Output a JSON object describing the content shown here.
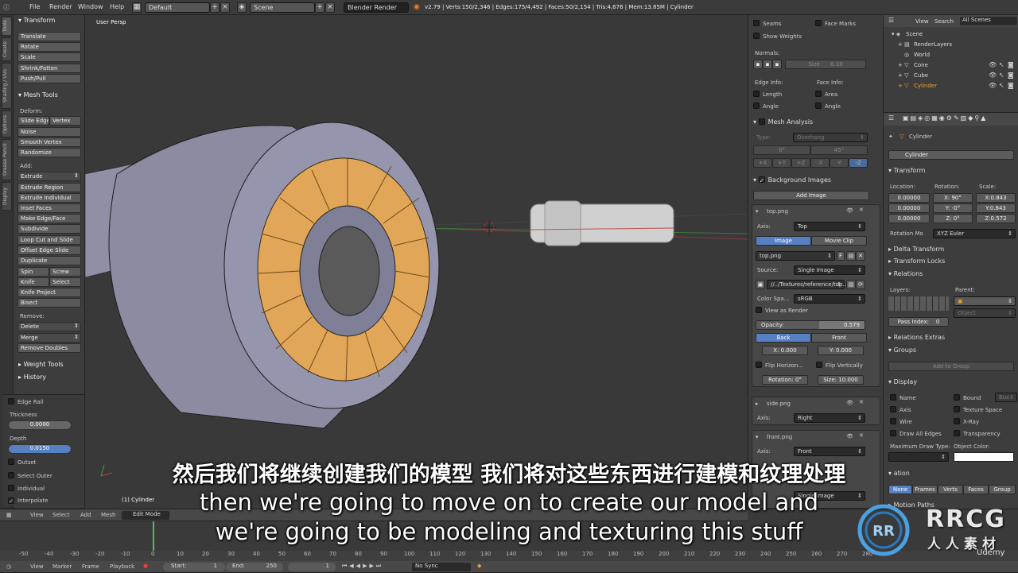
{
  "topbar": {
    "menus": [
      "File",
      "Render",
      "Window",
      "Help"
    ],
    "layout": "Default",
    "scene": "Scene",
    "engine": "Blender Render",
    "stats": "v2.79 | Verts:150/2,346 | Edges:175/4,492 | Faces:50/2,154 | Tris:4,676 | Mem:13.85M | Cylinder"
  },
  "toolshelf": {
    "tabs": [
      "Tools",
      "Create",
      "Shading / UVs",
      "Options",
      "Grease Pencil",
      "Display"
    ],
    "transform_title": "Transform",
    "transform_buttons": [
      "Translate",
      "Rotate",
      "Scale",
      "Shrink/Fatten",
      "Push/Pull"
    ],
    "mesh_tools_title": "Mesh Tools",
    "deform_label": "Deform:",
    "slide_edge": "Slide Edge",
    "vertex": "Vertex",
    "noise": "Noise",
    "smooth_vertex": "Smooth Vertex",
    "randomize": "Randomize",
    "add_label": "Add:",
    "extrude": "Extrude",
    "add_buttons": [
      "Extrude Region",
      "Extrude Individual",
      "Inset Faces",
      "Make Edge/Face",
      "Subdivide",
      "Loop Cut and Slide",
      "Offset Edge Slide",
      "Duplicate"
    ],
    "spin": "Spin",
    "screw": "Screw",
    "knife": "Knife",
    "select": "Select",
    "knife_project": "Knife Project",
    "bisect": "Bisect",
    "remove_label": "Remove:",
    "delete": "Delete",
    "merge": "Merge",
    "remove_doubles": "Remove Doubles",
    "weight_tools": "Weight Tools",
    "history": "History",
    "op_edge_rail": "Edge Rail",
    "op_thickness_label": "Thickness",
    "op_thickness": "0.0000",
    "op_depth_label": "Depth",
    "op_depth": "0.0150",
    "op_outset": "Outset",
    "op_select_outer": "Select Outer",
    "op_individual": "Individual",
    "op_interpolate": "Interpolate"
  },
  "viewport": {
    "title": "User Persp",
    "object_label": "(1) Cylinder"
  },
  "nprop": {
    "seams": "Seams",
    "face_marks": "Face Marks",
    "show_weights": "Show Weights",
    "normals": "Normals:",
    "size_label": "Size",
    "size_value": "0.10",
    "edge_info": "Edge Info:",
    "face_info": "Face Info:",
    "length": "Length",
    "area": "Area",
    "angle": "Angle",
    "angle2": "Angle",
    "mesh_analysis": "Mesh Analysis",
    "type_label": "Type:",
    "type_value": "Overhang",
    "range_min": "0°",
    "range_max": "45°",
    "axis_buttons": [
      "+X",
      "+Y",
      "+Z",
      "-X",
      "-Y",
      "-Z"
    ],
    "bg_images": "Background Images",
    "add_image": "Add Image",
    "img1_name": "top.png",
    "axis_label": "Axis:",
    "img1_axis": "Top",
    "image_tab": "Image",
    "movie_clip_tab": "Movie Clip",
    "img1_file": "top.png",
    "img1_f": "F",
    "source_label": "Source:",
    "source_value": "Single Image",
    "filepath": "//../Textures/reference/top...",
    "colorspace_label": "Color Spa...",
    "colorspace_value": "sRGB",
    "view_as_render": "View as Render",
    "opacity_label": "Opacity:",
    "opacity_value": "0.579",
    "back": "Back",
    "front": "Front",
    "x_label": "X:",
    "x_value": "0.000",
    "y_label": "Y:",
    "y_value": "0.000",
    "flip_h": "Flip Horizon...",
    "flip_v": "Flip Vertically",
    "rotation_label": "Rotation:",
    "rotation_value": "0°",
    "size2_label": "Size:",
    "size2_value": "10.000",
    "img2_name": "side.png",
    "img2_axis": "Right",
    "img3_name": "front.png",
    "img3_axis": "Front",
    "img3_source": "Single Image"
  },
  "outliner": {
    "view": "View",
    "search": "Search",
    "all_scenes": "All Scenes",
    "items": [
      "Scene",
      "RenderLayers",
      "World",
      "Cone",
      "Cube",
      "Cylinder"
    ]
  },
  "properties": {
    "object_name": "Cylinder",
    "object_field": "Cylinder",
    "transform": "Transform",
    "location": "Location:",
    "rotation": "Rotation:",
    "scale": "Scale:",
    "loc": [
      "0.00000",
      "0.00000",
      "0.00000"
    ],
    "rot": [
      "X:    90°",
      "Y:    -0°",
      "Z:     0°"
    ],
    "scl": [
      "X:0.843",
      "Y:0.843",
      "Z:0.572"
    ],
    "rotation_mode_label": "Rotation Mo",
    "rotation_mode": "XYZ Euler",
    "delta_transform": "Delta Transform",
    "transform_locks": "Transform Locks",
    "relations": "Relations",
    "layers": "Layers:",
    "parent": "Parent:",
    "parent_type": "Object",
    "pass_index_label": "Pass Index:",
    "pass_index": "0",
    "relations_extras": "Relations Extras",
    "groups": "Groups",
    "add_to_group": "Add to Group",
    "display": "Display",
    "name": "Name",
    "bounds": "Bound",
    "bounds_type": "Box",
    "axis": "Axis",
    "texture_space": "Texture Space",
    "wire": "Wire",
    "xray": "X-Ray",
    "draw_all_edges": "Draw All Edges",
    "transparency": "Transparency",
    "max_draw_type": "Maximum Draw Type:",
    "object_color": "Object Color:",
    "duplication": "ation",
    "dup_tabs": [
      "None",
      "Frames",
      "Verts",
      "Faces",
      "Group"
    ],
    "motion_paths": "Motion Paths"
  },
  "timeline": {
    "view": "View",
    "select": "Select",
    "add": "Add",
    "mesh": "Mesh",
    "mode": "Edit Mode",
    "tl_view": "View",
    "marker": "Marker",
    "frame": "Frame",
    "playback": "Playback",
    "start_label": "Start:",
    "start": "1",
    "end_label": "End:",
    "end": "250",
    "current": "1",
    "sync": "No Sync",
    "ticks": [
      "-50",
      "-40",
      "-30",
      "-20",
      "-10",
      "0",
      "10",
      "20",
      "30",
      "40",
      "50",
      "60",
      "70",
      "80",
      "90",
      "100",
      "110",
      "120",
      "130",
      "140",
      "150",
      "160",
      "170",
      "180",
      "190",
      "200",
      "210",
      "220",
      "230",
      "240",
      "250",
      "260",
      "270",
      "280"
    ]
  },
  "subtitles": {
    "zh": "然后我们将继续创建我们的模型 我们将对这些东西进行建模和纹理处理",
    "en1": "then we're going to move on to create our model and",
    "en2": "we're going to be modeling and texturing this stuff"
  },
  "watermark": {
    "brand": "RRCG",
    "brand_cn": "人人素材",
    "udemy": "Udemy"
  },
  "colors": {
    "selection_orange": "#f0a030",
    "accent_blue": "#5680c2",
    "viewport_bg": "#393939"
  }
}
